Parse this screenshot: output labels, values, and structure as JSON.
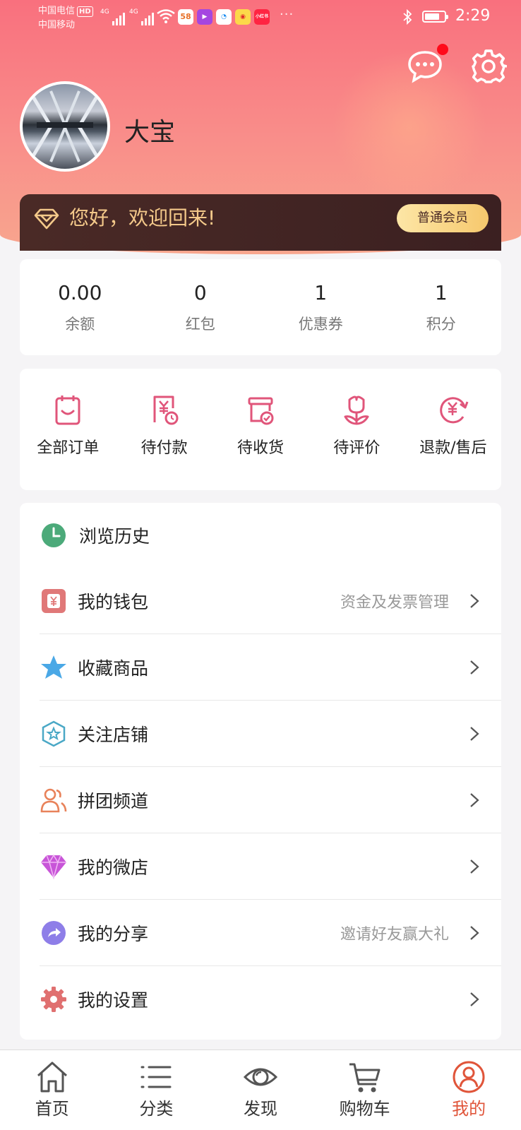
{
  "status_bar": {
    "carrier1": "中国电信",
    "hd": "HD",
    "carrier2": "中国移动",
    "net1": "4G",
    "net2": "4G",
    "app_58": "58",
    "app_xhs": "小红书",
    "more": "···",
    "time": "2:29",
    "battery_level": 0.75
  },
  "profile": {
    "username": "大宝",
    "welcome": "您好，欢迎回来!",
    "member_level": "普通会员"
  },
  "stats": [
    {
      "value": "0.00",
      "label": "余额"
    },
    {
      "value": "0",
      "label": "红包"
    },
    {
      "value": "1",
      "label": "优惠券"
    },
    {
      "value": "1",
      "label": "积分"
    }
  ],
  "orders": [
    {
      "label": "全部订单",
      "icon": "clipboard-icon"
    },
    {
      "label": "待付款",
      "icon": "yen-bill-icon"
    },
    {
      "label": "待收货",
      "icon": "box-check-icon"
    },
    {
      "label": "待评价",
      "icon": "flower-icon"
    },
    {
      "label": "退款/售后",
      "icon": "yen-refresh-icon"
    }
  ],
  "menu": {
    "history": "浏览历史",
    "items": [
      {
        "label": "我的钱包",
        "hint": "资金及发票管理",
        "icon": "wallet-icon"
      },
      {
        "label": "收藏商品",
        "hint": "",
        "icon": "star-icon"
      },
      {
        "label": "关注店铺",
        "hint": "",
        "icon": "shop-star-icon"
      },
      {
        "label": "拼团频道",
        "hint": "",
        "icon": "group-icon"
      },
      {
        "label": "我的微店",
        "hint": "",
        "icon": "diamond-icon"
      },
      {
        "label": "我的分享",
        "hint": "邀请好友赢大礼",
        "icon": "share-icon"
      },
      {
        "label": "我的设置",
        "hint": "",
        "icon": "gear-icon"
      }
    ]
  },
  "tabbar": [
    {
      "label": "首页",
      "icon": "home-icon"
    },
    {
      "label": "分类",
      "icon": "list-icon"
    },
    {
      "label": "发现",
      "icon": "eye-icon"
    },
    {
      "label": "购物车",
      "icon": "cart-icon"
    },
    {
      "label": "我的",
      "icon": "user-icon",
      "active": true
    }
  ],
  "colors": {
    "accent": "#e0553a",
    "header_top": "#f9707e",
    "header_bottom": "#f8a68e",
    "welcome_bg": "#4a2a26",
    "welcome_text": "#f4c98a",
    "icon_pink": "#e0557a"
  }
}
